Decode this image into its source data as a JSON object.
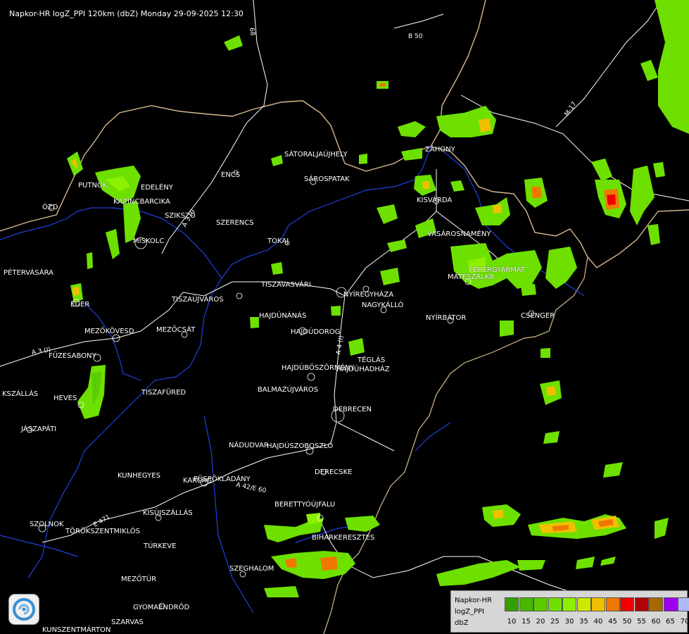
{
  "header": {
    "title": "Napkor-HR logZ_PPI 120km (dbZ) Monday 29-09-2025 12:30"
  },
  "towns": [
    {
      "id": "satoraljaujhely",
      "label": "SÁTORALJAÚJHELY"
    },
    {
      "id": "sarospatak",
      "label": "SÁROSPATAK"
    },
    {
      "id": "encs",
      "label": "ENCS"
    },
    {
      "id": "putnok",
      "label": "PUTNOK"
    },
    {
      "id": "edeleny",
      "label": "EDELÉNY"
    },
    {
      "id": "kazincbarcika",
      "label": "KAZINCBARCIKA"
    },
    {
      "id": "ozd",
      "label": "ÓZD"
    },
    {
      "id": "szikszo",
      "label": "SZIKSZÓ"
    },
    {
      "id": "szerencs",
      "label": "SZERENCS"
    },
    {
      "id": "miskolc",
      "label": "MISKOLC"
    },
    {
      "id": "tokaj",
      "label": "TOKAJ"
    },
    {
      "id": "petervasara",
      "label": "PÉTERVÁSÁRA"
    },
    {
      "id": "eger",
      "label": "EGER"
    },
    {
      "id": "tiszaujvaros",
      "label": "TISZAÚJVÁROS"
    },
    {
      "id": "tiszavasvari",
      "label": "TISZAVASVÁRI"
    },
    {
      "id": "mezokovesd",
      "label": "MEZŐKÖVESD"
    },
    {
      "id": "mezocsat",
      "label": "MEZŐCSÁT"
    },
    {
      "id": "fuzesabony",
      "label": "FÜZESABONY"
    },
    {
      "id": "hajdunanas",
      "label": "HAJDÚNÁNÁS"
    },
    {
      "id": "hajdudorog",
      "label": "HAJDÚDOROG"
    },
    {
      "id": "nyiregyhaza",
      "label": "NYÍREGYHÁZA"
    },
    {
      "id": "nagykallo",
      "label": "NAGYKÁLLÓ"
    },
    {
      "id": "kisvarda",
      "label": "KISVÁRDA"
    },
    {
      "id": "zahony",
      "label": "ZÁHONY"
    },
    {
      "id": "vasarosnameny",
      "label": "VÁSÁROSNAMÉNY"
    },
    {
      "id": "fehergyarmat",
      "label": "FEHÉRGYARMAT"
    },
    {
      "id": "mateszalka",
      "label": "MÁTÉSZALKA"
    },
    {
      "id": "nyirbator",
      "label": "NYÍRBÁTOR"
    },
    {
      "id": "csenger",
      "label": "CSENGER"
    },
    {
      "id": "teglas",
      "label": "TÉGLÁS"
    },
    {
      "id": "hajduboszormeny",
      "label": "HAJDÚBÖSZÖRMÉNY"
    },
    {
      "id": "hajduhadhaz",
      "label": "HAJDÚHADHÁZ"
    },
    {
      "id": "balmazujvaros",
      "label": "BALMAZÚJVÁROS"
    },
    {
      "id": "debrecen",
      "label": "DEBRECEN"
    },
    {
      "id": "tiszafured",
      "label": "TISZAFÜRED"
    },
    {
      "id": "kszallas",
      "label": "KSZÁLLÁS"
    },
    {
      "id": "heves",
      "label": "HEVES"
    },
    {
      "id": "jaszapati",
      "label": "JÁSZAPÁTI"
    },
    {
      "id": "nadudvar",
      "label": "NÁDUDVAR"
    },
    {
      "id": "hajduszoboszlo",
      "label": "HAJDÚSZOBOSZLÓ"
    },
    {
      "id": "kunhegyes",
      "label": "KUNHEGYES"
    },
    {
      "id": "karcag",
      "label": "KARCAG"
    },
    {
      "id": "puspokladany",
      "label": "PÜSPÖKLADÁNY"
    },
    {
      "id": "derecske",
      "label": "DERECSKE"
    },
    {
      "id": "berettyoujfalu",
      "label": "BERETTYÓÚJFALU"
    },
    {
      "id": "biharkeresztes",
      "label": "BIHARKERESZTES"
    },
    {
      "id": "kisujszallas",
      "label": "KISÚJSZÁLLÁS"
    },
    {
      "id": "szolnok",
      "label": "SZOLNOK"
    },
    {
      "id": "torokszentmiklos",
      "label": "TÖRÖKSZENTMIKLÓS"
    },
    {
      "id": "turkeve",
      "label": "TÚRKEVE"
    },
    {
      "id": "szeghalom",
      "label": "SZEGHALOM"
    },
    {
      "id": "mezotur",
      "label": "MEZŐTÚR"
    },
    {
      "id": "gyomaendrod",
      "label": "GYOMAENDRŐD"
    },
    {
      "id": "szarvas",
      "label": "SZARVAS"
    },
    {
      "id": "kunszentmarton",
      "label": "KUNSZENTMÁRTON"
    }
  ],
  "roads": {
    "r68": "68",
    "b50": "B 50",
    "m17": "M-17",
    "a3a": "A 3 (I)",
    "a3b": "A 3 (I)",
    "a4": "A 4 (I)",
    "a42": "A 42/E 60",
    "e471": "E 471"
  },
  "legend": {
    "caption": [
      "Napkor-HR",
      "logZ_PPI",
      "dbZ"
    ],
    "scale": [
      {
        "value": "10",
        "color": "#33a000"
      },
      {
        "value": "15",
        "color": "#48b800"
      },
      {
        "value": "20",
        "color": "#5acc00"
      },
      {
        "value": "25",
        "color": "#6ee000"
      },
      {
        "value": "30",
        "color": "#8cf000"
      },
      {
        "value": "35",
        "color": "#cce800"
      },
      {
        "value": "40",
        "color": "#f0c000"
      },
      {
        "value": "45",
        "color": "#f07800"
      },
      {
        "value": "50",
        "color": "#f00000"
      },
      {
        "value": "55",
        "color": "#b00000"
      },
      {
        "value": "60",
        "color": "#a86800"
      },
      {
        "value": "65",
        "color": "#a000f0"
      },
      {
        "value": "70",
        "color": "#b0b8f8"
      }
    ]
  }
}
